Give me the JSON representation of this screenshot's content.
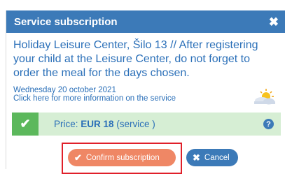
{
  "dialog": {
    "title": "Service subscription",
    "close_glyph": "✖",
    "description": "Holiday Leisure Center, Šilo 13 // After registering your child at the Leisure Center, do not forget to order the meal for the days chosen.",
    "date": "Wednesday 20 october 2021",
    "info_link": "Click here for more information on the service",
    "weather_icon": "sun-cloud-icon"
  },
  "price": {
    "label": "Price: ",
    "amount": "EUR 18",
    "suffix": " (service )",
    "check_glyph": "✔",
    "help_glyph": "?"
  },
  "buttons": {
    "confirm_label": "Confirm subscription",
    "confirm_glyph": "✔",
    "cancel_label": "Cancel",
    "cancel_glyph": "✖"
  },
  "colors": {
    "titlebar": "#3c7ab8",
    "text": "#2a6fb8",
    "price_bg": "#d6eed4",
    "check_bg": "#5cb85c",
    "confirm": "#ef8765",
    "cancel": "#3c7ab8",
    "highlight": "#e0202a"
  }
}
